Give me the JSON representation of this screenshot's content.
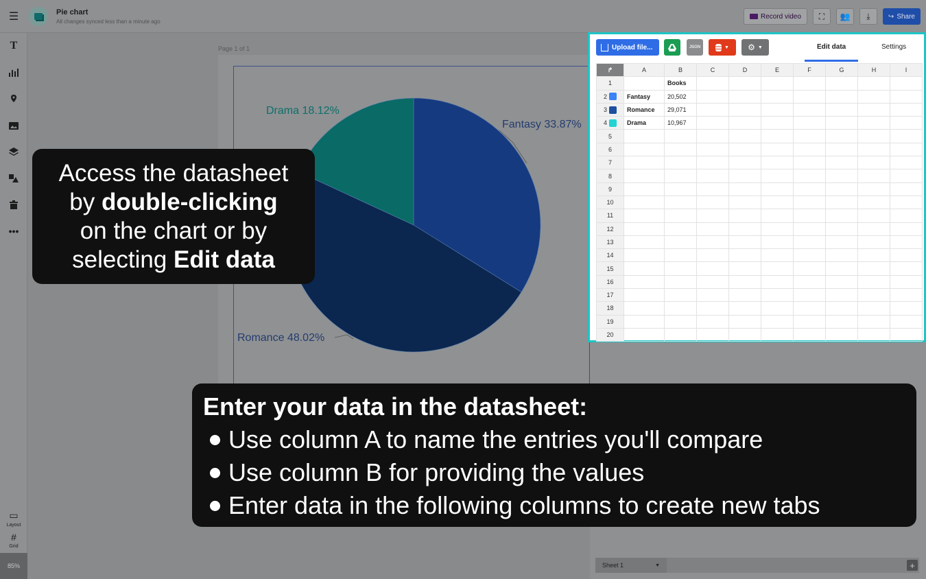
{
  "document": {
    "title": "Pie chart",
    "sync_status": "All changes synced less than a minute ago",
    "page_label": "Page 1 of 1",
    "zoom": "85%"
  },
  "toolbar": {
    "record_label": "Record video",
    "share_label": "Share"
  },
  "left_rail": {
    "items": [
      "text-icon",
      "chart-icon",
      "map-icon",
      "image-icon",
      "layers-icon",
      "shapes-icon",
      "trash-icon",
      "more-icon"
    ],
    "layout_label": "Layout",
    "grid_label": "Grid"
  },
  "datasheet": {
    "upload_label": "Upload file...",
    "json_label": "JSON",
    "tabs": {
      "edit": "Edit data",
      "settings": "Settings"
    },
    "columns": [
      "A",
      "B",
      "C",
      "D",
      "E",
      "F",
      "G",
      "H",
      "I"
    ],
    "header_row": {
      "row": "1",
      "a": "",
      "b": "Books"
    },
    "rows": [
      {
        "row": "2",
        "name": "Fantasy",
        "value": "20,502",
        "color": "#3b82f6"
      },
      {
        "row": "3",
        "name": "Romance",
        "value": "29,071",
        "color": "#1e4fa0"
      },
      {
        "row": "4",
        "name": "Drama",
        "value": "10,967",
        "color": "#22d3d3"
      }
    ],
    "empty_rows": [
      "5",
      "6",
      "7",
      "8",
      "9",
      "10",
      "11",
      "12",
      "13",
      "14",
      "15",
      "16",
      "17",
      "18",
      "19",
      "20"
    ],
    "sheet_tab": "Sheet 1"
  },
  "chart_data": {
    "type": "pie",
    "slices": [
      {
        "label": "Fantasy 33.87%",
        "value": 20502,
        "color": "#163a80"
      },
      {
        "label": "Romance 48.02%",
        "value": 29071,
        "color": "#0b274f"
      },
      {
        "label": "Drama 18.12%",
        "value": 10967,
        "color": "#0a6a66"
      }
    ]
  },
  "overlay_left": {
    "line1": "Access the datasheet",
    "line2_pre": "by ",
    "line2_bold": "double-clicking",
    "line3": "on the chart or by",
    "line4_pre": "selecting ",
    "line4_bold": "Edit data"
  },
  "overlay_bottom": {
    "heading": "Enter your data in the datasheet:",
    "bullets": [
      "Use column A to name the entries you'll compare",
      "Use column B for providing the values",
      "Enter data in the following columns to create new tabs"
    ]
  }
}
